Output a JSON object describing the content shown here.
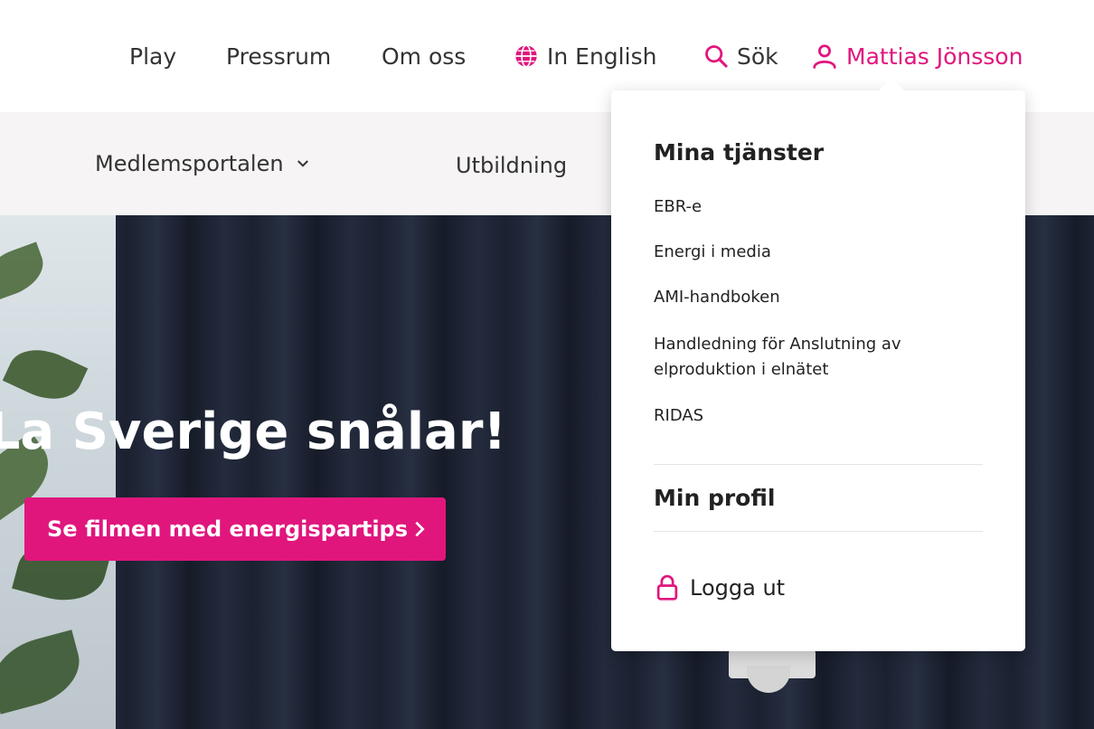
{
  "topnav": {
    "play": "Play",
    "pressrum": "Pressrum",
    "om_oss": "Om oss",
    "english": "In English",
    "search": "Sök",
    "user": "Mattias Jönsson"
  },
  "subnav": {
    "medlemsportalen": "Medlemsportalen",
    "utbildning": "Utbildning"
  },
  "hero": {
    "title": "nELa Sverige snålar!",
    "cta": "Se filmen med energispartips"
  },
  "dropdown": {
    "services_heading": "Mina tjänster",
    "services": [
      "EBR-e",
      "Energi i media",
      "AMI-handboken",
      "Handledning för Anslutning av elproduktion i elnätet",
      "RIDAS"
    ],
    "profile": "Min profil",
    "logout": "Logga ut"
  },
  "colors": {
    "accent": "#e0167d",
    "hero_bg": "#1b2130",
    "subnav_bg": "#f6f4f4"
  },
  "icons": [
    "globe-icon",
    "search-icon",
    "user-icon",
    "chevron-down-icon",
    "chevron-right-icon",
    "lock-icon"
  ]
}
